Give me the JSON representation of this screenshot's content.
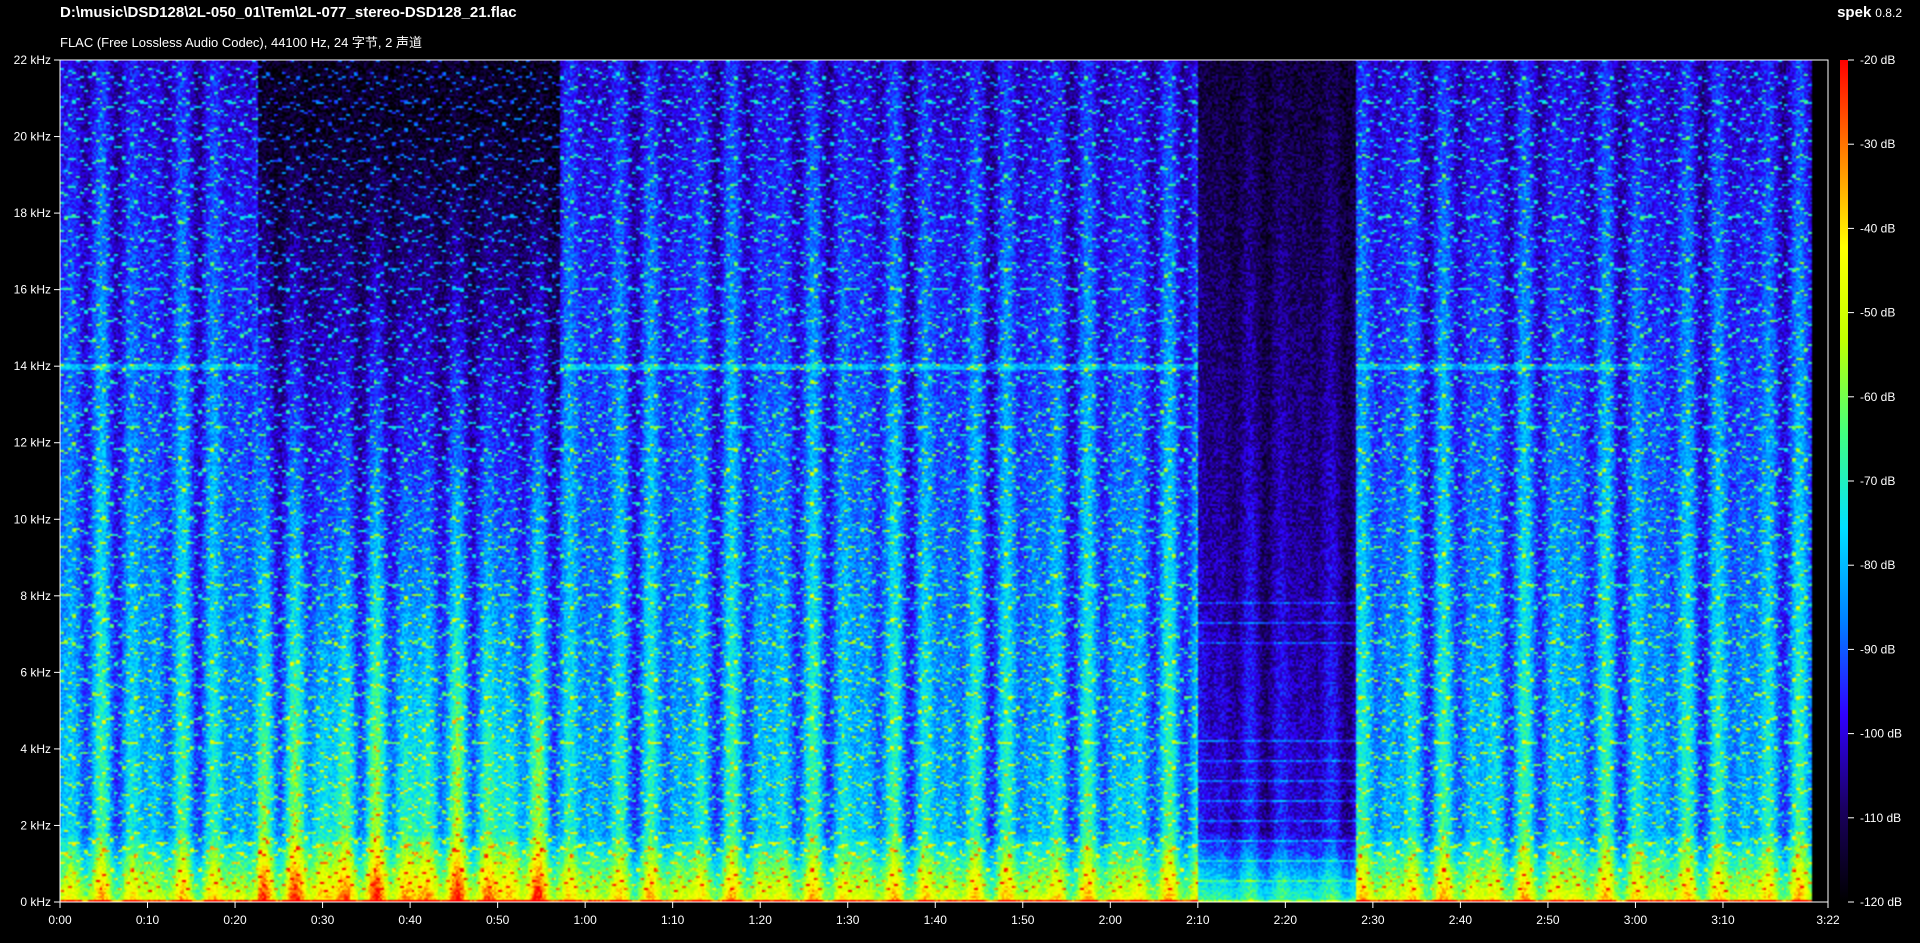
{
  "header": {
    "file_path": "D:\\music\\DSD128\\2L-050_01\\Tem\\2L-077_stereo-DSD128_21.flac",
    "file_info": "FLAC (Free Lossless Audio Codec), 44100 Hz, 24 字节, 2 声道",
    "app_name": "spek",
    "app_version": "0.8.2"
  },
  "chart_data": {
    "type": "heatmap",
    "title": "",
    "xlabel": "",
    "ylabel": "",
    "x_ticks": [
      "0:00",
      "0:10",
      "0:20",
      "0:30",
      "0:40",
      "0:50",
      "1:00",
      "1:10",
      "1:20",
      "1:30",
      "1:40",
      "1:50",
      "2:00",
      "2:10",
      "2:20",
      "2:30",
      "2:40",
      "2:50",
      "3:00",
      "3:10",
      "3:22"
    ],
    "x_tick_seconds": [
      0,
      10,
      20,
      30,
      40,
      50,
      60,
      70,
      80,
      90,
      100,
      110,
      120,
      130,
      140,
      150,
      160,
      170,
      180,
      190,
      202
    ],
    "xlim": [
      0,
      202
    ],
    "y_ticks": [
      "0 kHz",
      "2 kHz",
      "4 kHz",
      "6 kHz",
      "8 kHz",
      "10 kHz",
      "12 kHz",
      "14 kHz",
      "16 kHz",
      "18 kHz",
      "20 kHz",
      "22 kHz"
    ],
    "y_tick_khz": [
      0,
      2,
      4,
      6,
      8,
      10,
      12,
      14,
      16,
      18,
      20,
      22
    ],
    "ylim": [
      0,
      22
    ],
    "colorbar": {
      "ticks": [
        "-20 dB",
        "-30 dB",
        "-40 dB",
        "-50 dB",
        "-60 dB",
        "-70 dB",
        "-80 dB",
        "-90 dB",
        "-100 dB",
        "-110 dB",
        "-120 dB"
      ],
      "range_db": [
        -120,
        -20
      ],
      "colors": [
        "#000000",
        "#1a0060",
        "#3000ff",
        "#0080ff",
        "#00e0ff",
        "#40ff80",
        "#c0ff00",
        "#ffff00",
        "#ff8000",
        "#ff0000"
      ]
    },
    "segments": [
      {
        "start": 0,
        "end": 22.5,
        "texture": "dense-harmonics"
      },
      {
        "start": 22.5,
        "end": 57,
        "texture": "low-frequency-ensemble"
      },
      {
        "start": 57,
        "end": 130,
        "texture": "dense-harmonics"
      },
      {
        "start": 130,
        "end": 148,
        "texture": "quiet"
      },
      {
        "start": 148,
        "end": 182,
        "texture": "dense-harmonics"
      },
      {
        "start": 182,
        "end": 200,
        "texture": "sustained-harmonics"
      }
    ]
  }
}
